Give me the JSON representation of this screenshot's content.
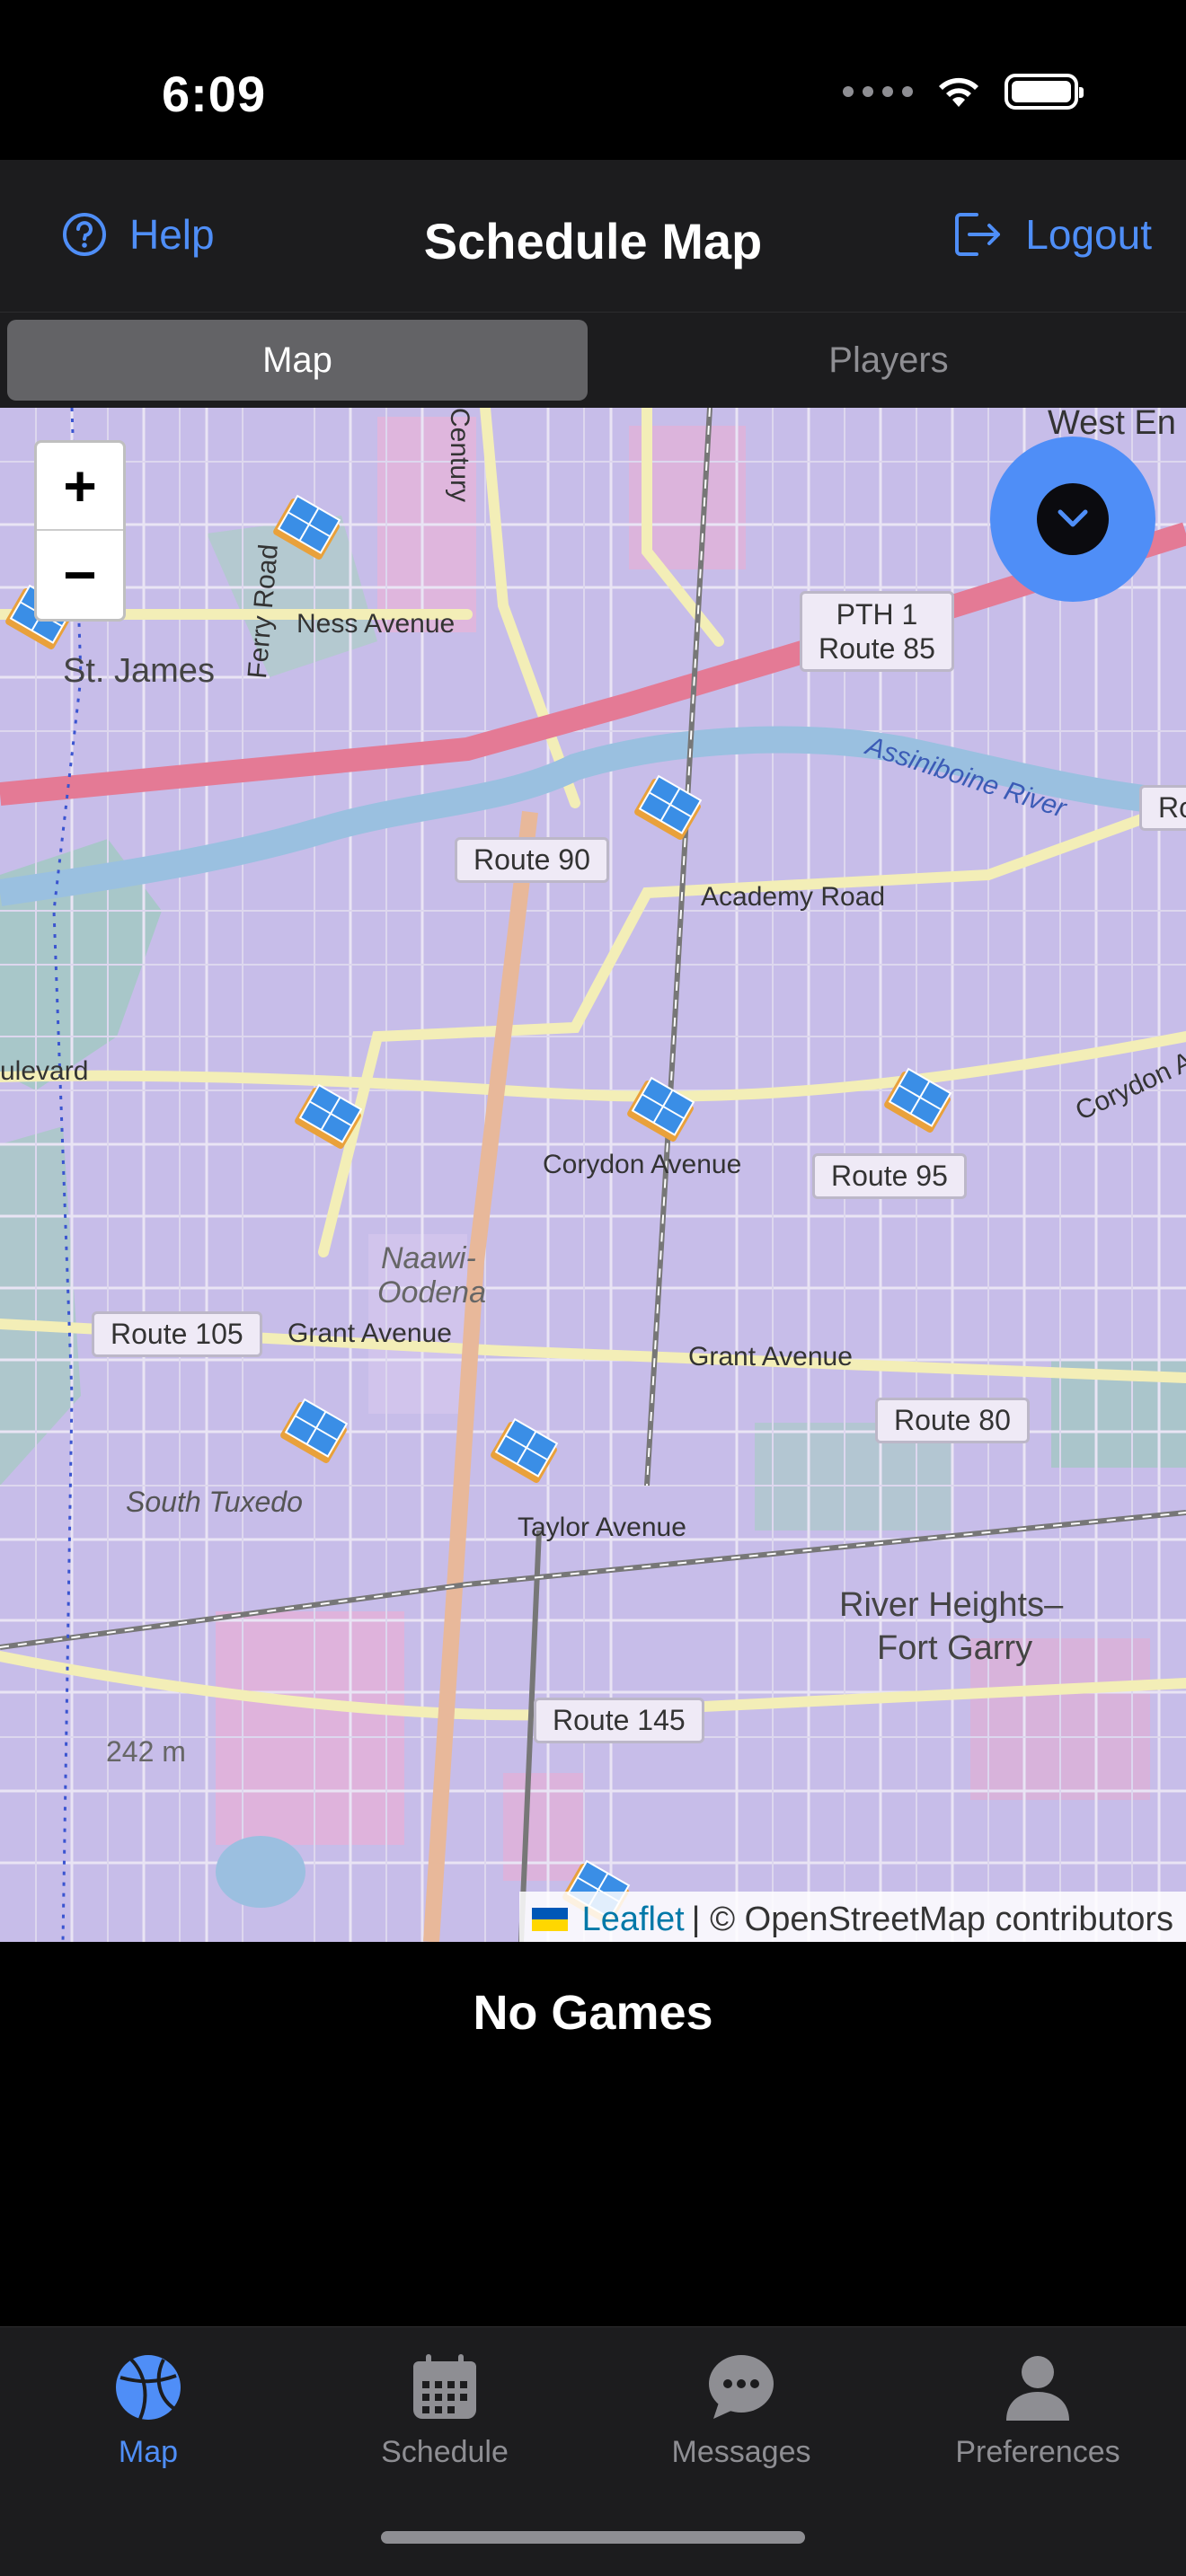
{
  "status_bar": {
    "time": "6:09",
    "icons": [
      "signal-dots",
      "wifi-icon",
      "battery-icon"
    ]
  },
  "header": {
    "help_label": "Help",
    "title": "Schedule Map",
    "logout_label": "Logout",
    "accent_color": "#4f8ef7"
  },
  "segments": [
    {
      "label": "Map",
      "selected": true
    },
    {
      "label": "Players",
      "selected": false
    }
  ],
  "map": {
    "zoom_in": "+",
    "zoom_out": "−",
    "attribution_link": "Leaflet",
    "attribution_text": "| © OpenStreetMap contributors",
    "labels": {
      "ness": "Ness Avenue",
      "ferry": "Ferry Road",
      "academy": "Academy Road",
      "assiniboine": "Assiniboine River",
      "corydon": "Corydon Avenue",
      "corydon_av": "Corydon Av",
      "grant1": "Grant Avenue",
      "grant2": "Grant Avenue",
      "taylor": "Taylor Avenue",
      "west_en": "West En",
      "ulevard": "ulevard",
      "century": "Century",
      "ro": "Ro"
    },
    "shields": {
      "pth1": "PTH 1",
      "route85": "Route 85",
      "route90": "Route 90",
      "route95": "Route 95",
      "route105": "Route 105",
      "route80": "Route 80",
      "route145": "Route 145"
    },
    "places": {
      "st_james": "St. James",
      "naawi1": "Naawi-",
      "naawi2": "Oodena",
      "south_tuxedo": "South Tuxedo",
      "river_heights1": "River Heights–",
      "river_heights2": "Fort Garry",
      "elevation": "242 m"
    },
    "marker_icon": "tennis-court-icon"
  },
  "content": {
    "empty_message": "No Games"
  },
  "tabs": [
    {
      "label": "Map",
      "icon": "basketball-icon",
      "active": true
    },
    {
      "label": "Schedule",
      "icon": "calendar-icon",
      "active": false
    },
    {
      "label": "Messages",
      "icon": "chat-bubble-icon",
      "active": false
    },
    {
      "label": "Preferences",
      "icon": "person-icon",
      "active": false
    }
  ]
}
